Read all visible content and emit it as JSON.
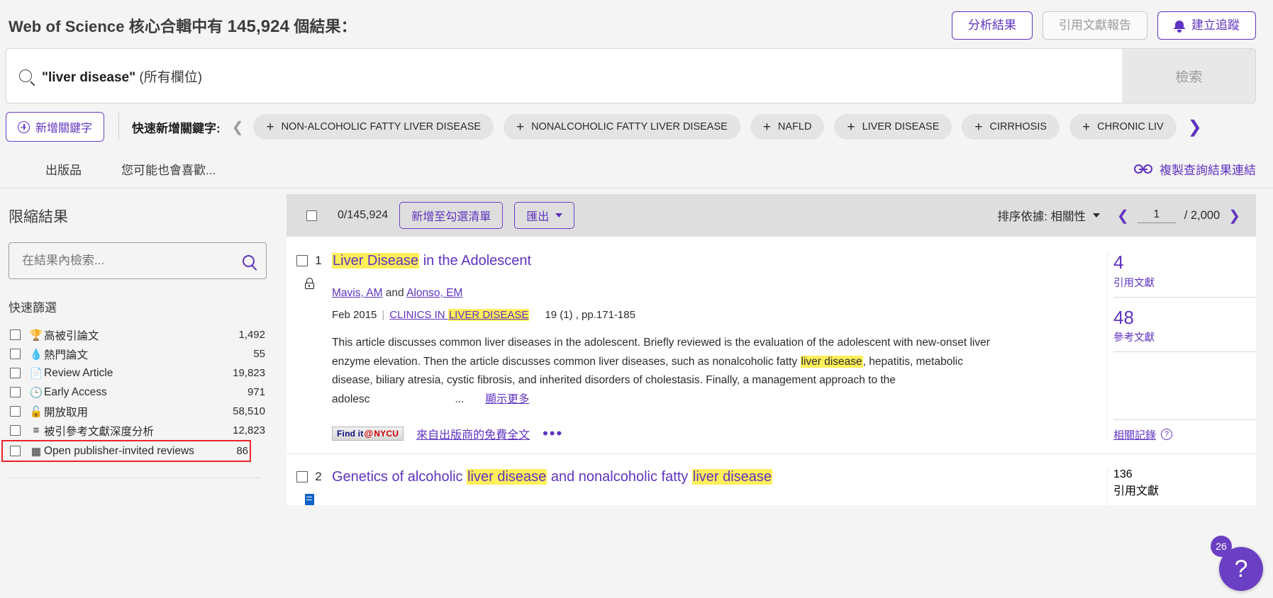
{
  "header": {
    "prefix": "Web of Science 核心合輯中有 ",
    "count": "145,924",
    "suffix": " 個結果：",
    "analyze_label": "分析結果",
    "citation_report_label": "引用文獻報告",
    "create_alert_label": "建立追蹤"
  },
  "search": {
    "query": "\"liver disease\"",
    "field": " (所有欄位)",
    "button_label": "檢索"
  },
  "keywords": {
    "add_label": "新增關鍵字",
    "quick_label": "快速新增關鍵字:",
    "chips": [
      "NON-ALCOHOLIC FATTY LIVER DISEASE",
      "NONALCOHOLIC FATTY LIVER DISEASE",
      "NAFLD",
      "LIVER DISEASE",
      "CIRRHOSIS",
      "CHRONIC LIV"
    ]
  },
  "tabs": [
    {
      "label": "出版品"
    },
    {
      "label": "您可能也會喜歡..."
    }
  ],
  "copy_link_label": "複製查詢結果連結",
  "sidebar": {
    "title": "限縮結果",
    "refine_placeholder": "在結果內檢索...",
    "quick_filters_title": "快速篩選",
    "filters": [
      {
        "icon": "trophy-icon",
        "glyph": "🏆",
        "label": "高被引論文",
        "count": "1,492"
      },
      {
        "icon": "flame-icon",
        "glyph": "🔥",
        "label": "熱門論文",
        "count": "55"
      },
      {
        "icon": "document-icon",
        "glyph": "📄",
        "label": "Review Article",
        "count": "19,823"
      },
      {
        "icon": "clock-icon",
        "glyph": "🕑",
        "label": "Early Access",
        "count": "971"
      },
      {
        "icon": "open-lock-icon",
        "glyph": "🔓",
        "label": "開放取用",
        "count": "58,510"
      },
      {
        "icon": "enriched-cited-references-icon",
        "glyph": "≡",
        "label": "被引參考文獻深度分析",
        "count": "12,823"
      },
      {
        "icon": "comment-icon",
        "glyph": "▤",
        "label": "Open publisher-invited reviews",
        "count": "86"
      }
    ],
    "highlight_color": "#e8262a"
  },
  "toolbar": {
    "selected_label": "0/145,924",
    "add_to_marked_label": "新增至勾選清單",
    "export_label": "匯出",
    "sort_label": "排序依據: 相關性",
    "page_value": "1",
    "page_total": "/ 2,000"
  },
  "results": [
    {
      "number": "1",
      "title_parts": [
        {
          "text": "Liver Disease",
          "highlight": true
        },
        {
          "text": " in the Adolescent",
          "highlight": false
        }
      ],
      "authors_prefix": "",
      "author1": "Mavis, AM",
      "author_join": " and ",
      "author2": "Alonso, EM",
      "date": "Feb 2015",
      "journal_parts": [
        {
          "text": "CLINICS IN ",
          "highlight": false
        },
        {
          "text": "LIVER DISEASE",
          "highlight": true
        }
      ],
      "pages": "19 (1) , pp.171-185",
      "abstract_parts": [
        {
          "text": "This article discusses common liver diseases in the adolescent. Briefly reviewed is the evaluation of the adolescent with new-onset liver enzyme elevation. Then the article discusses common liver diseases, such as nonalcoholic fatty ",
          "highlight": false
        },
        {
          "text": "liver disease",
          "highlight": true
        },
        {
          "text": ", hepatitis, metabolic disease, biliary atresia, cystic fibrosis, and inherited disorders of cholestasis. Finally, a management approach to the adolesc",
          "highlight": false
        }
      ],
      "ellipsis": "...",
      "show_more": "顯示更多",
      "findit_pre": "Find it",
      "findit_at": "@",
      "findit_org": "NYCU",
      "free_fulltext": "來自出版商的免費全文",
      "citations_count": "4",
      "citations_label": "引用文獻",
      "references_count": "48",
      "references_label": "參考文獻",
      "related_label": "相關記錄"
    },
    {
      "number": "2",
      "title_parts": [
        {
          "text": "Genetics of alcoholic ",
          "highlight": false
        },
        {
          "text": "liver disease",
          "highlight": true
        },
        {
          "text": " and nonalcoholic fatty ",
          "highlight": false
        },
        {
          "text": "liver disease",
          "highlight": true
        }
      ],
      "citations_count": "136",
      "citations_label": "引用文獻"
    }
  ],
  "help": {
    "badge": "26",
    "glyph": "?"
  },
  "colors": {
    "accent": "#5e33bf",
    "highlight": "#ffef5a",
    "alert": "#e8262a"
  }
}
